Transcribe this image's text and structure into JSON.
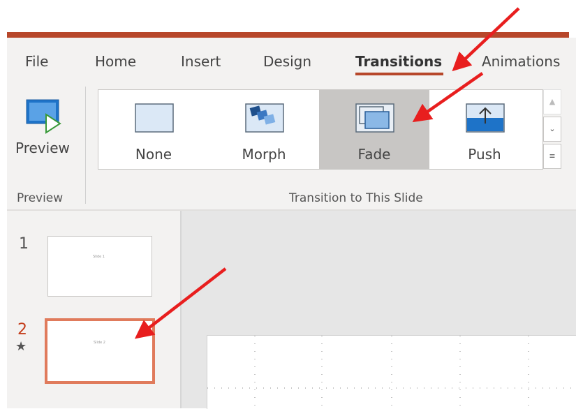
{
  "tabs": [
    {
      "label": "File",
      "active": false
    },
    {
      "label": "Home",
      "active": false
    },
    {
      "label": "Insert",
      "active": false
    },
    {
      "label": "Design",
      "active": false
    },
    {
      "label": "Transitions",
      "active": true
    },
    {
      "label": "Animations",
      "active": false
    }
  ],
  "ribbon": {
    "preview_button": {
      "label": "Preview",
      "icon": "preview-icon"
    },
    "preview_group_label": "Preview",
    "transition_group_label": "Transition to This Slide",
    "gallery": [
      {
        "label": "None",
        "icon": "none-transition-icon",
        "selected": false
      },
      {
        "label": "Morph",
        "icon": "morph-transition-icon",
        "selected": false
      },
      {
        "label": "Fade",
        "icon": "fade-transition-icon",
        "selected": true
      },
      {
        "label": "Push",
        "icon": "push-transition-icon",
        "selected": false
      }
    ]
  },
  "slides": [
    {
      "number": "1",
      "thumb_text": "Slide 1",
      "active": false,
      "has_transition": false
    },
    {
      "number": "2",
      "thumb_text": "Slide 2",
      "active": true,
      "has_transition": true
    }
  ],
  "colors": {
    "accent": "#b7472a",
    "annotation_arrow": "#e81e1e",
    "selected_gallery_item": "#c8c6c4"
  }
}
